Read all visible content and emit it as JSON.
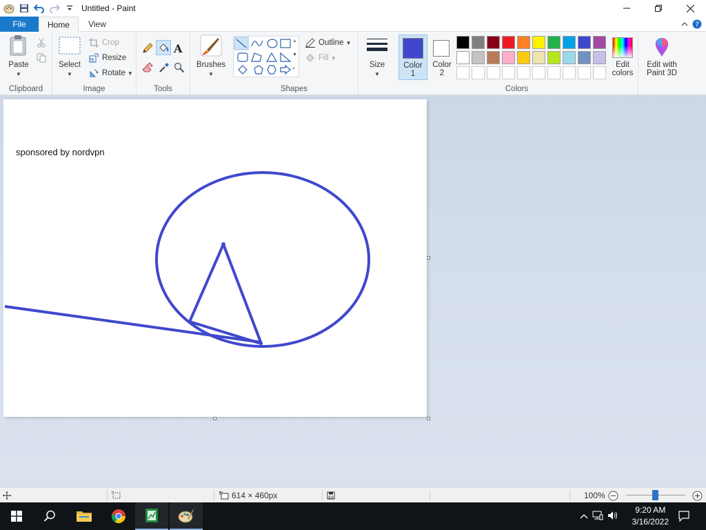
{
  "window": {
    "title": "Untitled - Paint"
  },
  "tabs": {
    "file": "File",
    "home": "Home",
    "view": "View"
  },
  "ribbon": {
    "clipboard": {
      "label": "Clipboard",
      "paste": "Paste"
    },
    "image": {
      "label": "Image",
      "select": "Select",
      "crop": "Crop",
      "resize": "Resize",
      "rotate": "Rotate"
    },
    "tools": {
      "label": "Tools"
    },
    "brushes": {
      "label": "Brushes"
    },
    "shapes": {
      "label": "Shapes",
      "outline": "Outline",
      "fill": "Fill"
    },
    "size": {
      "label": "Size"
    },
    "colors": {
      "label": "Colors",
      "color1": "Color",
      "color1_num": "1",
      "color2": "Color",
      "color2_num": "2",
      "edit_colors_1": "Edit",
      "edit_colors_2": "colors",
      "paint3d_1": "Edit with",
      "paint3d_2": "Paint 3D",
      "color1_value": "#3f48cc",
      "color2_value": "#ffffff",
      "palette_row1": [
        "#000000",
        "#7f7f7f",
        "#880015",
        "#ed1c24",
        "#ff7f27",
        "#fff200",
        "#22b14c",
        "#00a2e8",
        "#3f48cc",
        "#a349a4"
      ],
      "palette_row2": [
        "#ffffff",
        "#c3c3c3",
        "#b97a57",
        "#ffaec9",
        "#ffc90e",
        "#efe4b0",
        "#b5e61d",
        "#99d9ea",
        "#7092be",
        "#c8bfe7"
      ]
    }
  },
  "canvas": {
    "text": "sponsored by nordvpn",
    "stroke_color": "#3f48cc"
  },
  "status": {
    "dimensions": "614 × 460px",
    "zoom": "100%"
  },
  "taskbar": {
    "time": "9:20 AM",
    "date": "3/16/2022"
  }
}
